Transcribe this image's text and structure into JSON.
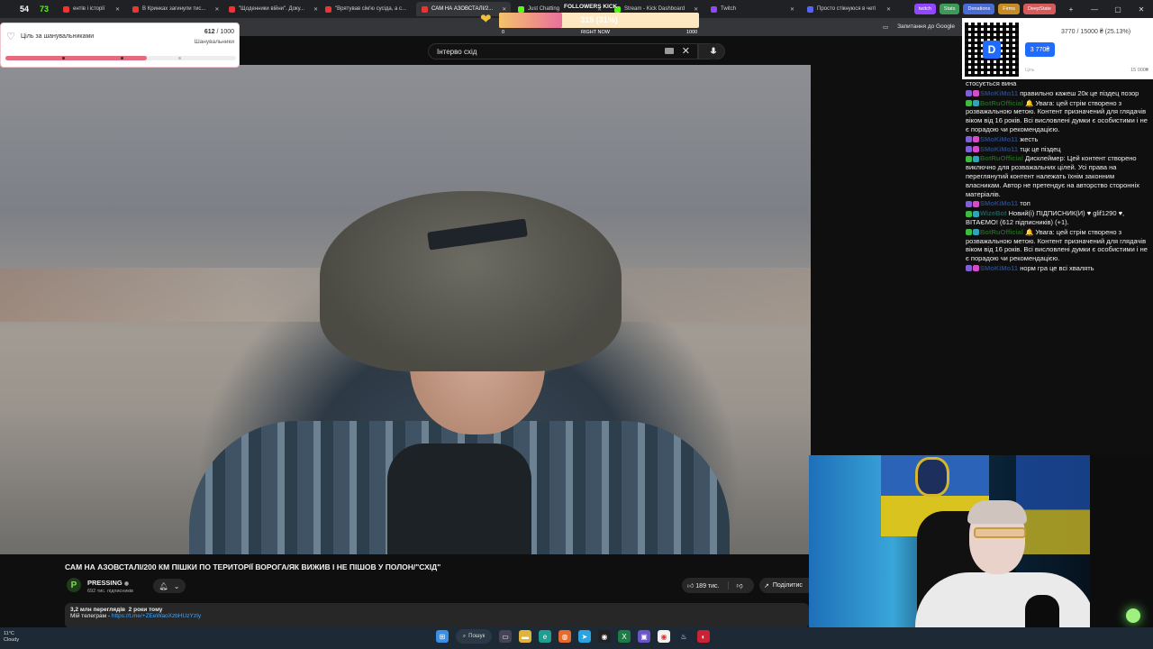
{
  "tabs": [
    {
      "label": "ентів і історії",
      "active": false
    },
    {
      "label": "В Кринках загинули тис...",
      "active": false
    },
    {
      "label": "\"Щоденники війни\". Доку...",
      "active": false
    },
    {
      "label": "\"Врятував сім'ю сусіда, а с...",
      "active": false
    },
    {
      "label": "САМ НА АЗОВСТАЛІ/2...",
      "active": true
    },
    {
      "label": "Just Chatting",
      "active": false
    },
    {
      "label": "Stream - Kick Dashboard",
      "active": false
    },
    {
      "label": "Twitch",
      "active": false
    },
    {
      "label": "Просто стікнуюся в четі",
      "active": false
    }
  ],
  "bookmarks": [
    "Stats",
    "Donations",
    "Firms",
    "DeepState"
  ],
  "tab_counts": {
    "first": "54",
    "second": "73"
  },
  "browser": {
    "google_question": "Запитання до Google"
  },
  "youtube": {
    "search_value": "Інтерво схід",
    "video": {
      "title": "САМ НА АЗОВСТАЛІ/200 КМ ПІШКИ ПО ТЕРИТОРІЇ ВОРОГА/ЯК ВИЖИВ І НЕ ПІШОВ У ПОЛОН/\"СХІД\"",
      "channel": "PRESSING",
      "subscribers": "692 тис. підписників",
      "likes": "189 тис.",
      "share_label": "Поділитис",
      "views": "3,2 млн переглядів",
      "age": "2 роки тому",
      "desc_prefix": "Мій телеграм - ",
      "telegram_link": "https://t.me/+ZEeWaoXzbHUzYzIy"
    }
  },
  "follower_goal": {
    "label": "Ціль за шанувальниками",
    "current": "612",
    "target": "1000",
    "sub_label": "Шанувальники",
    "progress": 0.612
  },
  "kick": {
    "label": "FOLLOWERS KICK",
    "value": "315 (31%)",
    "progress": 0.315,
    "min": "0",
    "mid": "RIGHT NOW",
    "max": "1000"
  },
  "donation": {
    "summary": "3770 / 15000 ₴ (25.13%)",
    "amount": "3 770₴",
    "label": "Ціль",
    "max": "15 000₴"
  },
  "chat": [
    {
      "user": "",
      "text": "стосується вина",
      "color": "blue"
    },
    {
      "user": "SMoKiMo11",
      "text": "правильно кажеш 20к це піздец позор",
      "color": "blue"
    },
    {
      "user": "BotRuOfficial",
      "text": "🔔 Увага: цей стрім створено з розважальною метою. Контент призначений для глядачів віком від 16 років. Всі висловлені думки є особистими і не є порадою чи рекомендацією.",
      "color": "green"
    },
    {
      "user": "SMoKiMo11",
      "text": "жесть",
      "color": "blue"
    },
    {
      "user": "SMoKiMo11",
      "text": "тцк це піздец",
      "color": "blue"
    },
    {
      "user": "BotRuOfficial",
      "text": "Дисклеймер: Цей контент створено виключно для розважальних цілей. Усі права на переглянутий контент належать їхнім законним власникам. Автор не претендує на авторство сторонніх матеріалів.",
      "color": "green"
    },
    {
      "user": "SMoKiMo11",
      "text": "топ",
      "color": "blue"
    },
    {
      "user": "WizeBot",
      "text": "Новий(і) ПІДПИСНИК(И) ♥ glif1290 ♥, ВІТАЄМО! (612 підписників) (+1).",
      "color": "teal"
    },
    {
      "user": "BotRuOfficial",
      "text": "🔔 Увага: цей стрім створено з розважальною метою. Контент призначений для глядачів віком від 16 років. Всі висловлені думки є особистими і не є порадою чи рекомендацією.",
      "color": "green"
    },
    {
      "user": "SMoKiMo11",
      "text": "норм гра це всі хвалять",
      "color": "blue"
    }
  ],
  "taskbar": {
    "temperature": "11°C",
    "weather": "Cloudy",
    "search_label": "Пошук"
  }
}
